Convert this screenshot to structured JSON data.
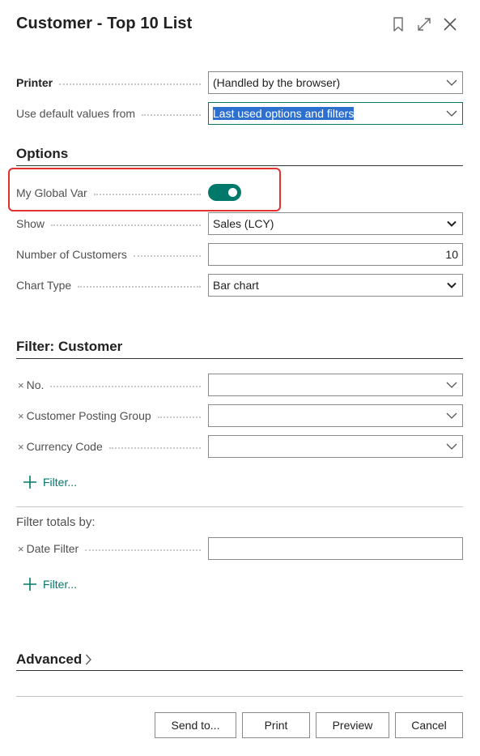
{
  "dialog": {
    "title": "Customer - Top 10 List"
  },
  "printer": {
    "label": "Printer",
    "value": "(Handled by the browser)"
  },
  "defaults": {
    "label": "Use default values from",
    "value": "Last used options and filters"
  },
  "options": {
    "title": "Options",
    "global_var": {
      "label": "My Global Var",
      "state": "on"
    },
    "show": {
      "label": "Show",
      "value": "Sales (LCY)"
    },
    "num_customers": {
      "label": "Number of Customers",
      "value": "10"
    },
    "chart_type": {
      "label": "Chart Type",
      "value": "Bar chart"
    }
  },
  "filter_customer": {
    "title": "Filter: Customer",
    "fields": [
      {
        "remove": "×",
        "label": "No.",
        "value": ""
      },
      {
        "remove": "×",
        "label": "Customer Posting Group",
        "value": ""
      },
      {
        "remove": "×",
        "label": "Currency Code",
        "value": ""
      }
    ],
    "add_filter": "Filter..."
  },
  "filter_totals": {
    "title": "Filter totals by:",
    "date_filter": {
      "remove": "×",
      "label": "Date Filter",
      "value": ""
    },
    "add_filter": "Filter..."
  },
  "advanced": {
    "label": "Advanced"
  },
  "footer": {
    "send_to": "Send to...",
    "print": "Print",
    "preview": "Preview",
    "cancel": "Cancel"
  },
  "colors": {
    "accent": "#00796b",
    "highlight_border": "#e03030",
    "selection": "#2c6fcf"
  }
}
